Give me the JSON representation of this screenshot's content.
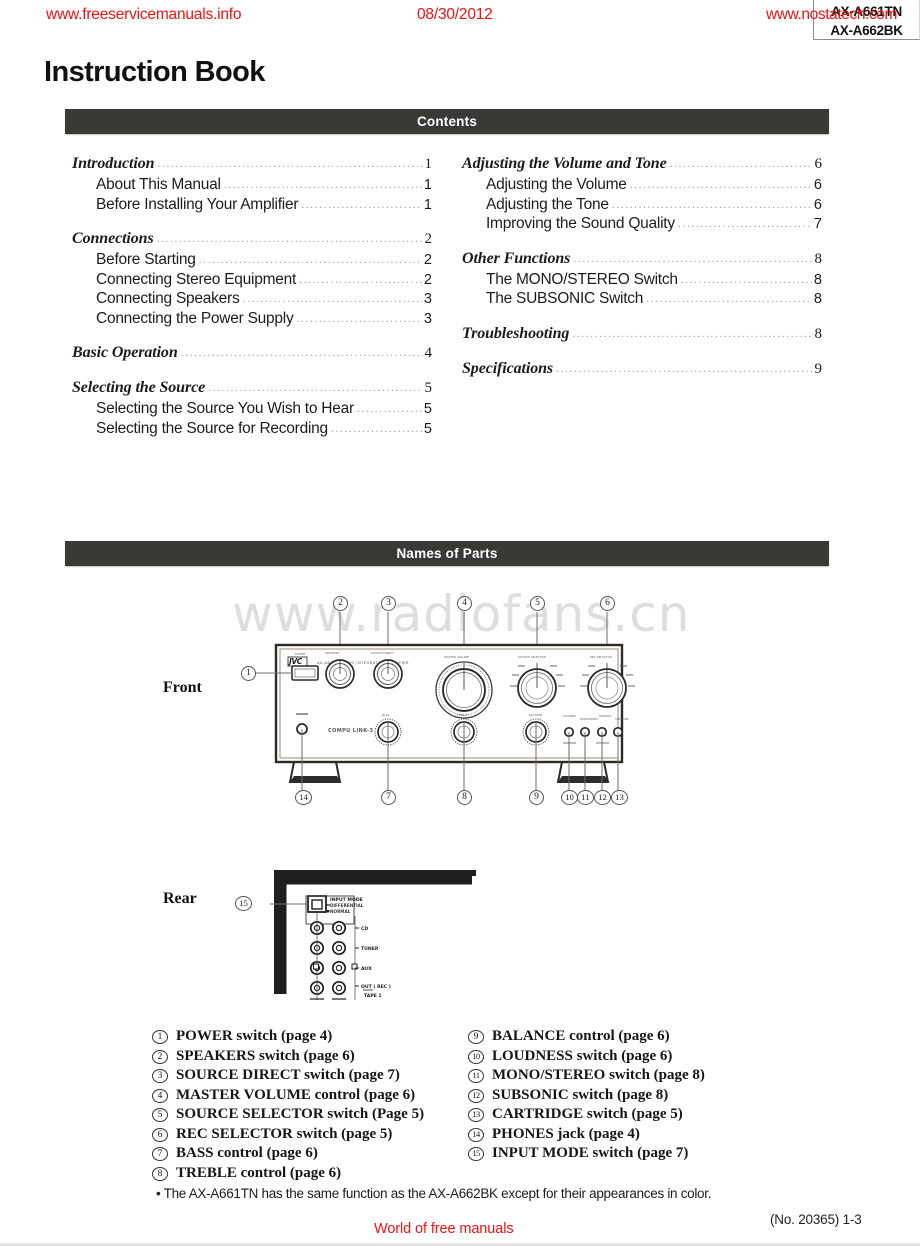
{
  "scan_header": {
    "left_url": "www.freeservicemanuals.info",
    "date": "08/30/2012",
    "right_url": "www.nostatech.com",
    "model_line_1": "AX-A661TN",
    "model_line_2": "AX-A662BK"
  },
  "title": "Instruction Book",
  "banners": {
    "contents": "Contents",
    "names_of_parts": "Names of Parts"
  },
  "watermark": "www.radiofans.cn",
  "toc": {
    "left": [
      {
        "head": {
          "label": "Introduction",
          "page": "1"
        },
        "subs": [
          {
            "label": "About This Manual",
            "page": "1"
          },
          {
            "label": "Before Installing Your Amplifier",
            "page": "1"
          }
        ]
      },
      {
        "head": {
          "label": "Connections",
          "page": "2"
        },
        "subs": [
          {
            "label": "Before Starting",
            "page": "2"
          },
          {
            "label": "Connecting Stereo Equipment",
            "page": "2"
          },
          {
            "label": "Connecting Speakers",
            "page": "3"
          },
          {
            "label": "Connecting the Power Supply",
            "page": "3"
          }
        ]
      },
      {
        "head": {
          "label": "Basic Operation",
          "page": "4"
        },
        "subs": []
      },
      {
        "head": {
          "label": "Selecting the Source",
          "page": "5"
        },
        "subs": [
          {
            "label": "Selecting the Source You Wish to Hear",
            "page": "5"
          },
          {
            "label": "Selecting the Source for Recording",
            "page": "5"
          }
        ]
      }
    ],
    "right": [
      {
        "head": {
          "label": "Adjusting the Volume and Tone",
          "page": "6"
        },
        "subs": [
          {
            "label": "Adjusting the Volume",
            "page": "6"
          },
          {
            "label": "Adjusting the Tone",
            "page": "6"
          },
          {
            "label": "Improving the Sound Quality",
            "page": "7"
          }
        ]
      },
      {
        "head": {
          "label": "Other Functions",
          "page": "8"
        },
        "subs": [
          {
            "label": "The MONO/STEREO Switch",
            "page": "8"
          },
          {
            "label": "The SUBSONIC Switch",
            "page": "8"
          }
        ]
      },
      {
        "head": {
          "label": "Troubleshooting",
          "page": "8"
        },
        "subs": []
      },
      {
        "head": {
          "label": "Specifications",
          "page": "9"
        },
        "subs": []
      }
    ]
  },
  "diagrams": {
    "front_label": "Front",
    "rear_label": "Rear",
    "front_brand": "JVC",
    "front_model_text": "AX-A661  STEREO INTEGRATED AMPLIFIER",
    "front_callouts_top": [
      "2",
      "3",
      "4",
      "5",
      "6"
    ],
    "front_callouts_bottom": [
      "14",
      "7",
      "8",
      "9",
      "10",
      "11",
      "12",
      "13"
    ],
    "front_callout_power": "1",
    "rear_callout": "15",
    "front_knob_labels": [
      "MASTER VOLUME",
      "SOURCE SELECTOR",
      "REC SELECTOR",
      "SPEAKERS",
      "SOURCE DIRECT",
      "BASS",
      "TREBLE",
      "BALANCE"
    ],
    "rear_switch_title": "INPUT MODE",
    "rear_switch_pos_1": "DIFFERENTIAL",
    "rear_switch_pos_2": "NORMAL",
    "rear_jack_labels": [
      "CD",
      "TUNER",
      "AUX",
      "OUT ( REC )",
      "TAPE 1"
    ]
  },
  "legend": {
    "left": [
      {
        "num": "1",
        "text": "POWER switch (page 4)"
      },
      {
        "num": "2",
        "text": "SPEAKERS switch (page 6)"
      },
      {
        "num": "3",
        "text": "SOURCE DIRECT switch (page 7)"
      },
      {
        "num": "4",
        "text": "MASTER VOLUME control (page 6)"
      },
      {
        "num": "5",
        "text": "SOURCE SELECTOR switch (Page 5)"
      },
      {
        "num": "6",
        "text": "REC SELECTOR switch (page 5)"
      },
      {
        "num": "7",
        "text": "BASS control (page 6)"
      },
      {
        "num": "8",
        "text": "TREBLE control (page 6)"
      }
    ],
    "right": [
      {
        "num": "9",
        "text": "BALANCE control (page 6)"
      },
      {
        "num": "10",
        "text": "LOUDNESS switch (page 6)"
      },
      {
        "num": "11",
        "text": "MONO/STEREO switch (page 8)"
      },
      {
        "num": "12",
        "text": "SUBSONIC switch (page 8)"
      },
      {
        "num": "13",
        "text": "CARTRIDGE switch (page 5)"
      },
      {
        "num": "14",
        "text": "PHONES jack (page 4)"
      },
      {
        "num": "15",
        "text": "INPUT MODE switch (page 7)"
      }
    ]
  },
  "footer": {
    "note": "• The AX-A661TN has the same function as the AX-A662BK except for their appearances in color.",
    "red_text": "World of free manuals",
    "page_number": "(No. 20365) 1-3"
  },
  "colors": {
    "banner_bg": "#3a3936",
    "scan_red": "#ee1111",
    "watermark_gray": "#dedede"
  }
}
